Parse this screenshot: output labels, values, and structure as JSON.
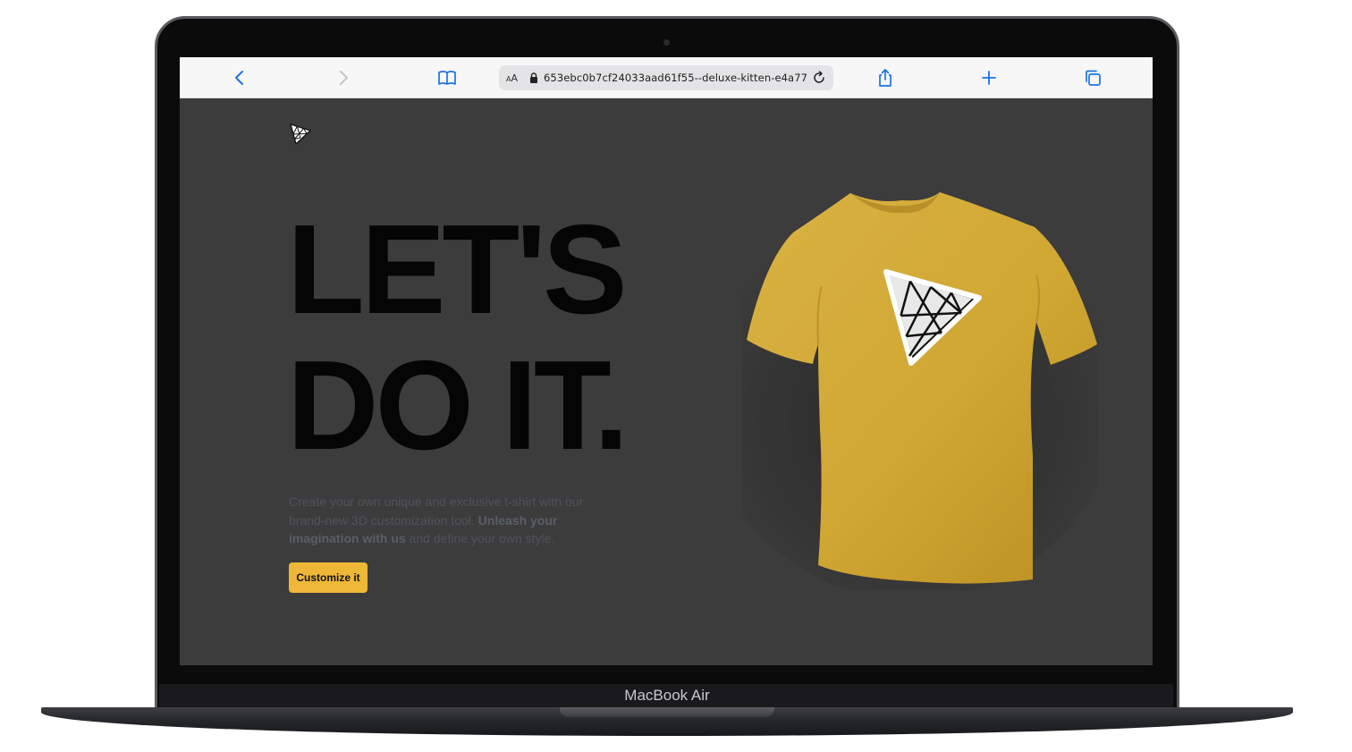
{
  "device": {
    "label": "MacBook Air"
  },
  "browser": {
    "reader_label": "AA",
    "url": "653ebc0b7cf24033aad61f55--deluxe-kitten-e4a77b"
  },
  "page": {
    "headline_line1": "LET'S",
    "headline_line2": "DO IT.",
    "intro_plain1": "Create your own unique and exclusive t-shirt with our brand-new 3D customization tool. ",
    "intro_bold": "Unleash your imagination with us",
    "intro_plain2": " and define your own style.",
    "cta_label": "Customize it"
  },
  "colors": {
    "page_background": "#3c3c3d",
    "accent": "#efb737",
    "shirt": "#d4aa3a",
    "toolbar_blue": "#1a73e8"
  },
  "icons": [
    "back-icon",
    "forward-icon",
    "bookmarks-icon",
    "lock-icon",
    "reload-icon",
    "share-icon",
    "new-tab-icon",
    "tabs-icon",
    "logo-icon"
  ]
}
